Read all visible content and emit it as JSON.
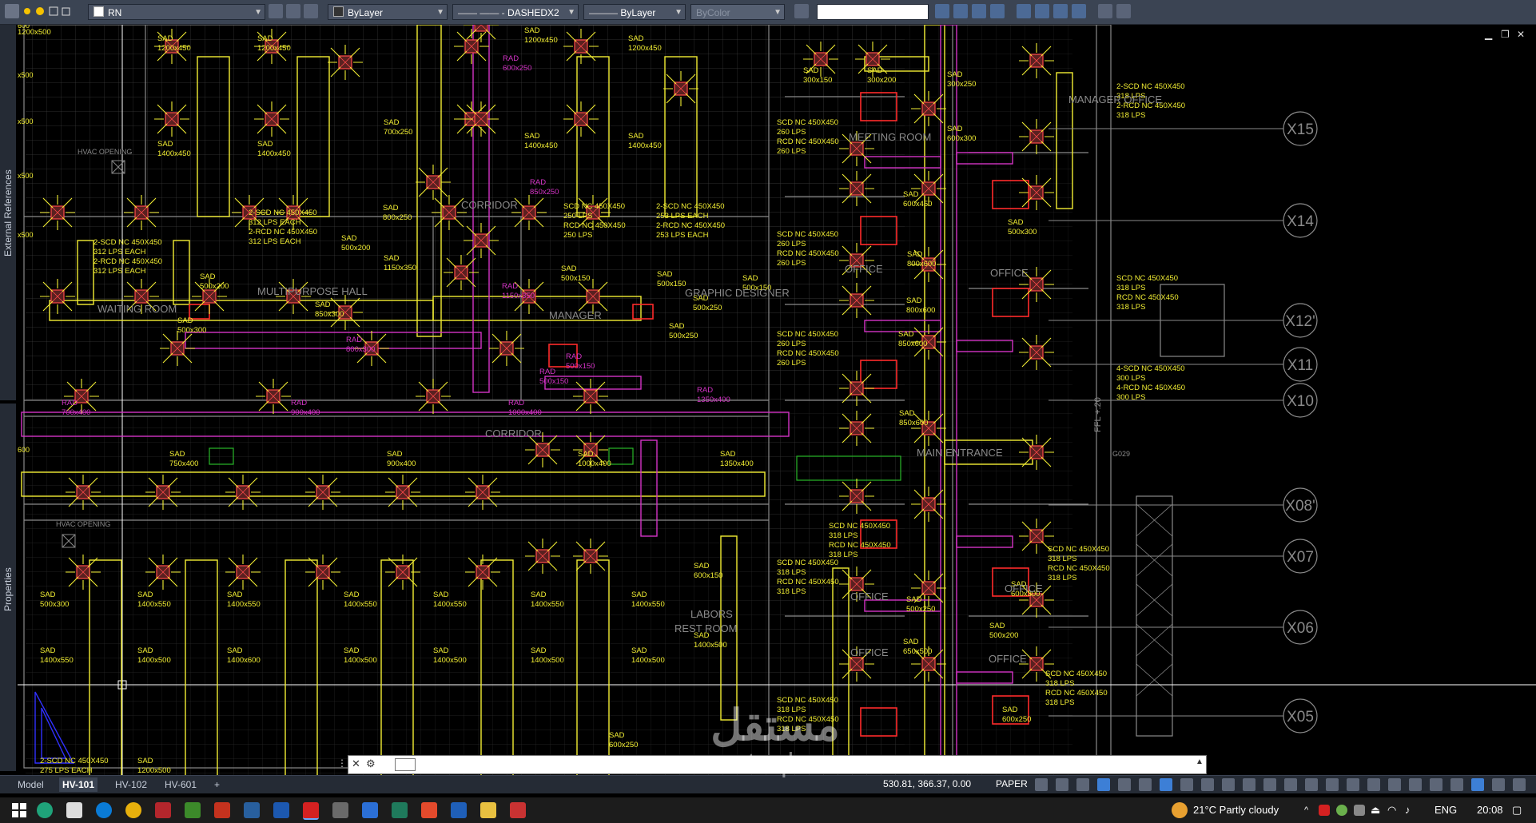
{
  "toolbar": {
    "layer_name": "RN",
    "color_combo": "ByLayer",
    "linetype_combo": "DASHEDX2",
    "lineweight_combo": "ByLayer",
    "plotstyle_combo": "ByColor",
    "search_value": ""
  },
  "palettes": {
    "external_references": "External References",
    "properties": "Properties"
  },
  "drawing": {
    "left_dims": [
      "600",
      "x500",
      "x500",
      "x500",
      "x500",
      "600"
    ],
    "rooms": [
      "CORRIDOR",
      "MULTIPURPOSE HALL",
      "WAITING ROOM",
      "MANAGER",
      "GRAPHIC DESIGNER",
      "MEETING ROOM",
      "MANAGER OFFICE",
      "OFFICE",
      "OFFICE",
      "CORRIDOR",
      "MAIN ENTRANCE",
      "LABORS REST ROOM",
      "OFFICE",
      "OFFICE",
      "OFFICE",
      "OFFICE",
      "HVAC OPENING",
      "HVAC OPENING"
    ],
    "grid_bubbles": [
      "X15",
      "X14",
      "X12'",
      "X11",
      "X10",
      "X08'",
      "X07",
      "X06",
      "X05"
    ],
    "level": "FFL +.20",
    "tag_g029": "G029",
    "labels": [
      {
        "t": "SAD\n1200x450"
      },
      {
        "t": "SAD\n1200x450"
      },
      {
        "t": "SAD\n1200x450"
      },
      {
        "t": "SAD\n1200x450"
      },
      {
        "t": "SAD\n1400x450"
      },
      {
        "t": "SAD\n1400x450"
      },
      {
        "t": "SAD\n1400x450"
      },
      {
        "t": "SAD\n1400x450"
      },
      {
        "t": "SAD\n700x250"
      },
      {
        "t": "SAD\n800x250"
      },
      {
        "t": "SAD\n1150x350"
      },
      {
        "t": "RAD\n600x250"
      },
      {
        "t": "RAD\n850x250"
      },
      {
        "t": "RAD\n1150x350"
      },
      {
        "t": "2-SCD NC 450X450\n312 LPS EACH\n2-RCD NC 450X450\n312 LPS EACH"
      },
      {
        "t": "2-SCD NC 450X450\n312 LPS EACH\n2-RCD NC 450X450\n312 LPS EACH"
      },
      {
        "t": "SCD NC 450X450\n250 LPS\nRCD NC 450X450\n250 LPS"
      },
      {
        "t": "2-SCD NC 450X450\n253 LPS EACH\n2-RCD NC 450X450\n253 LPS EACH"
      },
      {
        "t": "SAD\n500x200"
      },
      {
        "t": "SAD\n500x200"
      },
      {
        "t": "SAD\n850x300"
      },
      {
        "t": "SAD\n500x300"
      },
      {
        "t": "SAD\n500x150"
      },
      {
        "t": "SAD\n500x250"
      },
      {
        "t": "SAD\n500x150"
      },
      {
        "t": "SAD\n500x250"
      },
      {
        "t": "SAD\n500x150"
      },
      {
        "t": "RAD\n800x300"
      },
      {
        "t": "RAD\n500x150"
      },
      {
        "t": "RAD\n700x400"
      },
      {
        "t": "RAD\n900x400"
      },
      {
        "t": "RAD\n1000x400"
      },
      {
        "t": "RAD\n1350x400"
      },
      {
        "t": "RAD\n500x150"
      },
      {
        "t": "SAD\n750x400"
      },
      {
        "t": "SAD\n900x400"
      },
      {
        "t": "SAD\n1000x400"
      },
      {
        "t": "SAD\n1350x400"
      },
      {
        "t": "SAD\n300x150"
      },
      {
        "t": "SAD\n300x200"
      },
      {
        "t": "SAD\n300x250"
      },
      {
        "t": "SAD\n600x300"
      },
      {
        "t": "SAD\n600x450"
      },
      {
        "t": "SAD\n500x300"
      },
      {
        "t": "SAD\n800x600"
      },
      {
        "t": "SAD\n800x600"
      },
      {
        "t": "SAD\n850x600"
      },
      {
        "t": "SAD\n850x600"
      },
      {
        "t": "SCD NC 450X450\n260 LPS\nRCD NC 450X450\n260 LPS"
      },
      {
        "t": "SCD NC 450X450\n260 LPS\nRCD NC 450X450\n260 LPS"
      },
      {
        "t": "SCD NC 450X450\n260 LPS\nRCD NC 450X450\n260 LPS"
      },
      {
        "t": "2-SCD NC 450X450\n318 LPS\n2-RCD NC 450X450\n318 LPS"
      },
      {
        "t": "SCD NC 450X450\n318 LPS\nRCD NC 450X450\n318 LPS"
      },
      {
        "t": "4-SCD NC 450X450\n300 LPS\n4-RCD NC 450X450\n300 LPS"
      },
      {
        "t": "SCD NC 450X450\n318 LPS\nRCD NC 450X450\n318 LPS"
      },
      {
        "t": "SCD NC 450X450\n318 LPS\nRCD NC 450X450\n318 LPS"
      },
      {
        "t": "SCD NC 450X450\n318 LPS\nRCD NC 450X450\n318 LPS"
      },
      {
        "t": "SCD NC 450X450\n318 LPS\nRCD NC 450X450\n318 LPS"
      },
      {
        "t": "SCD NC 450X450\n318 LPS\nRCD NC 450X450\n318 LPS"
      },
      {
        "t": "SAD\n500x250"
      },
      {
        "t": "SAD\n650x500"
      },
      {
        "t": "SAD\n600x300"
      },
      {
        "t": "SAD\n500x200"
      },
      {
        "t": "SAD\n600x250"
      },
      {
        "t": "SAD\n500x300"
      },
      {
        "t": "SAD\n1400x550"
      },
      {
        "t": "SAD\n1400x550"
      },
      {
        "t": "SAD\n1400x550"
      },
      {
        "t": "SAD\n1400x550"
      },
      {
        "t": "SAD\n1400x550"
      },
      {
        "t": "SAD\n1400x550"
      },
      {
        "t": "SAD\n1400x550"
      },
      {
        "t": "SAD\n1400x500"
      },
      {
        "t": "SAD\n1400x600"
      },
      {
        "t": "SAD\n1400x500"
      },
      {
        "t": "SAD\n1400x500"
      },
      {
        "t": "SAD\n1400x500"
      },
      {
        "t": "SAD\n1400x500"
      },
      {
        "t": "SAD\n1400x500"
      },
      {
        "t": "SAD\n600x150"
      },
      {
        "t": "SAD\n600x250"
      },
      {
        "t": "2-SCD NC 450X450\n275 LPS EACH"
      },
      {
        "t": "SAD\n1200x500"
      },
      {
        "t": "SAD\n1200x500"
      }
    ]
  },
  "layout_tabs": {
    "model": "Model",
    "tabs": [
      "HV-101",
      "HV-102",
      "HV-601"
    ],
    "add": "+"
  },
  "status": {
    "coords": "530.81, 366.37, 0.00",
    "space": "PAPER"
  },
  "taskbar": {
    "weather": "21°C  Partly cloudy",
    "lang": "ENG",
    "time": "20:08"
  },
  "watermark": {
    "arabic": "مستقل",
    "latin": "mostaql.com"
  }
}
